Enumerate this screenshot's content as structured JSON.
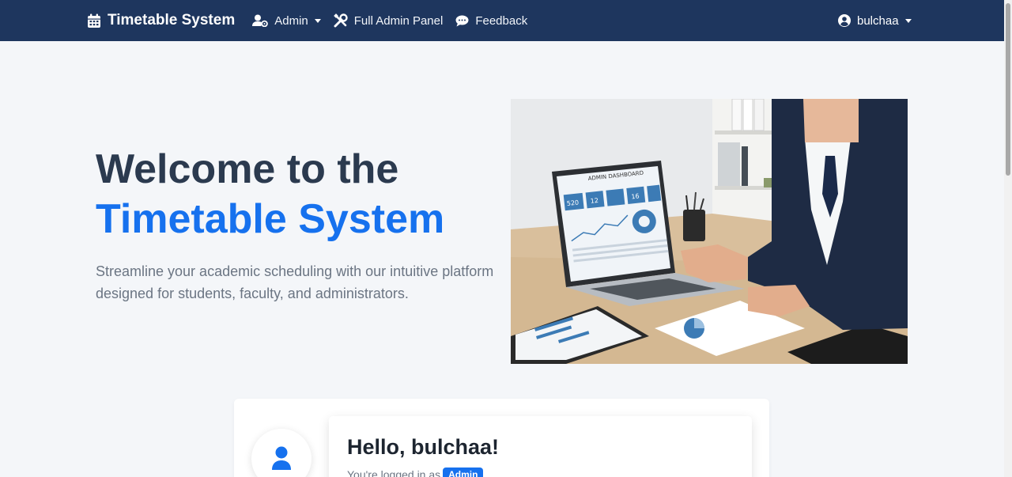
{
  "nav": {
    "brand": "Timetable System",
    "admin_menu": "Admin",
    "full_admin_panel": "Full Admin Panel",
    "feedback": "Feedback",
    "user": "bulchaa"
  },
  "hero": {
    "title_line1": "Welcome to the",
    "title_line2": "Timetable System",
    "subtitle": "Streamline your academic scheduling with our intuitive platform designed for students, faculty, and administrators."
  },
  "illustration": {
    "dashboard_title": "ADMIN DASHBOARD",
    "stats": [
      "520",
      "12",
      "16"
    ]
  },
  "welcome_card": {
    "greeting": "Hello, bulchaa!",
    "logged_in_prefix": "You're logged in as",
    "role": "Admin"
  },
  "colors": {
    "navbar": "#1e365e",
    "accent": "#1671ee",
    "heading": "#2b3a4f",
    "background": "#f4f6f9"
  },
  "icons": {
    "brand": "calendar-icon",
    "admin": "user-cog-icon",
    "admin_panel": "tools-icon",
    "feedback": "comment-icon",
    "user": "user-circle-icon",
    "avatar": "user-icon"
  }
}
